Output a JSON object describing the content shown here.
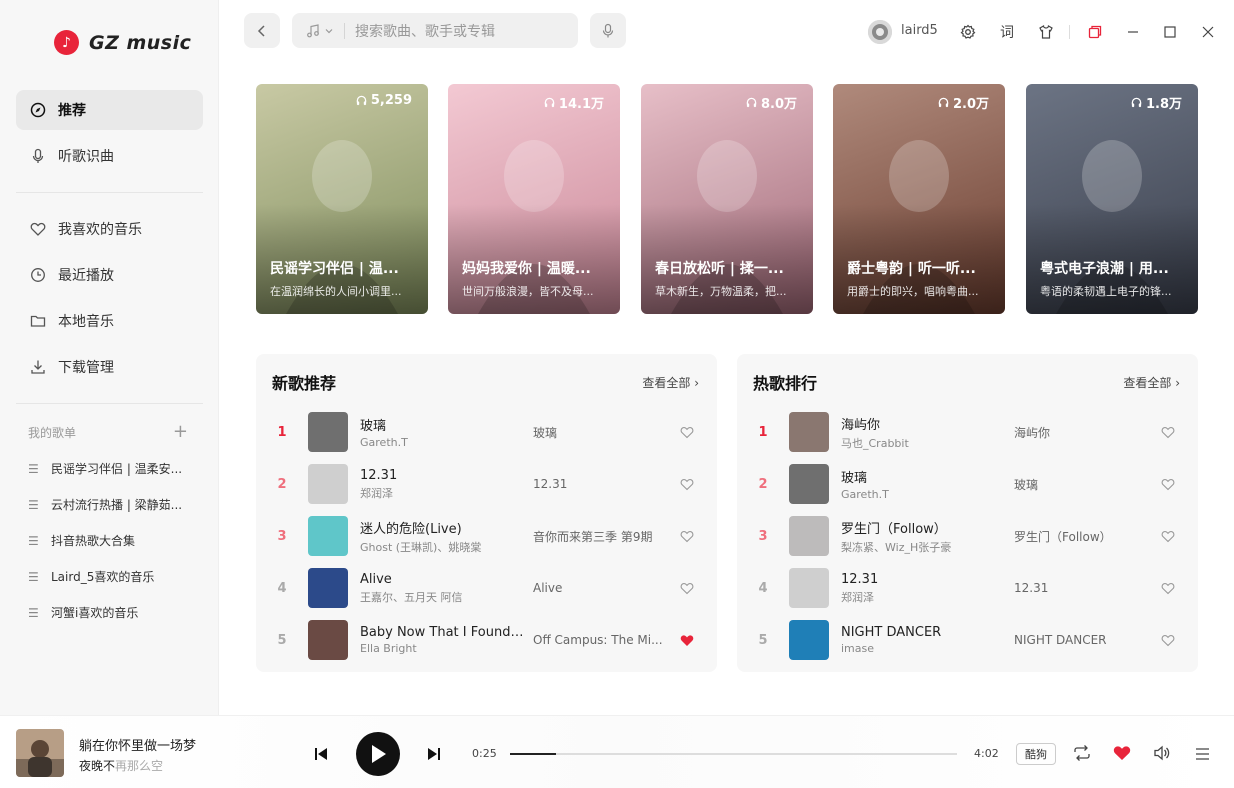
{
  "app": {
    "logo_text": "GZ music"
  },
  "sidebar": {
    "nav": [
      {
        "label": "推荐",
        "icon": "compass-icon"
      },
      {
        "label": "听歌识曲",
        "icon": "microphone-icon"
      }
    ],
    "library": [
      {
        "label": "我喜欢的音乐",
        "icon": "heart-icon"
      },
      {
        "label": "最近播放",
        "icon": "clock-icon"
      },
      {
        "label": "本地音乐",
        "icon": "folder-icon"
      },
      {
        "label": "下载管理",
        "icon": "download-icon"
      }
    ],
    "playlists_header": "我的歌单",
    "playlists": [
      "民谣学习伴侣 | 温柔安...",
      "云村流行热播 | 梁静茹...",
      "抖音热歌大合集",
      "Laird_5喜欢的音乐",
      "河蟹i喜欢的音乐"
    ]
  },
  "topbar": {
    "search_placeholder": "搜索歌曲、歌手或专辑",
    "username": "laird5",
    "lyrics_btn": "词"
  },
  "cards": [
    {
      "plays": "5,259",
      "title": "民谣学习伴侣 | 温...",
      "subtitle": "在温润绵长的人间小调里...",
      "color1": "#c8c9a4",
      "color2": "#7f8d5c"
    },
    {
      "plays": "14.1万",
      "title": "妈妈我爱你 | 温暖...",
      "subtitle": "世间万般浪漫，皆不及母...",
      "color1": "#f3c9d3",
      "color2": "#c98797"
    },
    {
      "plays": "8.0万",
      "title": "春日放松听 | 揉一...",
      "subtitle": "草木新生，万物温柔，把...",
      "color1": "#e7bfc8",
      "color2": "#9e6775"
    },
    {
      "plays": "2.0万",
      "title": "爵士粤韵 | 听一听...",
      "subtitle": "用爵士的即兴，唱响粤曲...",
      "color1": "#b08a7c",
      "color2": "#6a3d2f"
    },
    {
      "plays": "1.8万",
      "title": "粤式电子浪潮 | 用...",
      "subtitle": "粤语的柔韧遇上电子的锋...",
      "color1": "#6c7484",
      "color2": "#3a3f4c"
    }
  ],
  "new_songs": {
    "title": "新歌推荐",
    "more": "查看全部",
    "rows": [
      {
        "rank": "1",
        "name": "玻璃",
        "artist": "Gareth.T",
        "album": "玻璃",
        "liked": false,
        "thumb": "#6f6f6f"
      },
      {
        "rank": "2",
        "name": "12.31",
        "artist": "郑润泽",
        "album": "12.31",
        "liked": false,
        "thumb": "#cfcfcf"
      },
      {
        "rank": "3",
        "name": "迷人的危险(Live)",
        "artist": "Ghost (王琳凯)、姚晓棠",
        "album": "音你而来第三季 第9期",
        "liked": false,
        "thumb": "#5fc6c9"
      },
      {
        "rank": "4",
        "name": "Alive",
        "artist": "王嘉尔、五月天 阿信",
        "album": "Alive",
        "liked": false,
        "thumb": "#2c4a8a"
      },
      {
        "rank": "5",
        "name": "Baby Now That I Found ...",
        "artist": "Ella Bright",
        "album": "Off Campus: The Mi...",
        "liked": true,
        "thumb": "#6a4a44"
      }
    ]
  },
  "hot_songs": {
    "title": "热歌排行",
    "more": "查看全部",
    "rows": [
      {
        "rank": "1",
        "name": "海屿你",
        "artist": "马也_Crabbit",
        "album": "海屿你",
        "liked": false,
        "thumb": "#8a7770"
      },
      {
        "rank": "2",
        "name": "玻璃",
        "artist": "Gareth.T",
        "album": "玻璃",
        "liked": false,
        "thumb": "#6f6f6f"
      },
      {
        "rank": "3",
        "name": "罗生门（Follow）",
        "artist": "梨冻紧、Wiz_H张子豪",
        "album": "罗生门（Follow）",
        "liked": false,
        "thumb": "#bdbbbb"
      },
      {
        "rank": "4",
        "name": "12.31",
        "artist": "郑润泽",
        "album": "12.31",
        "liked": false,
        "thumb": "#cfcfcf"
      },
      {
        "rank": "5",
        "name": "NIGHT DANCER",
        "artist": "imase",
        "album": "NIGHT DANCER",
        "liked": false,
        "thumb": "#1f7fb7"
      }
    ]
  },
  "player": {
    "title": "躺在你怀里做一场梦",
    "lyric_main": "夜晚不",
    "lyric_rest": "再那么空",
    "current_time": "0:25",
    "total_time": "4:02",
    "progress": 0.104,
    "source_tag": "酷狗",
    "accent": "#e8243a"
  }
}
